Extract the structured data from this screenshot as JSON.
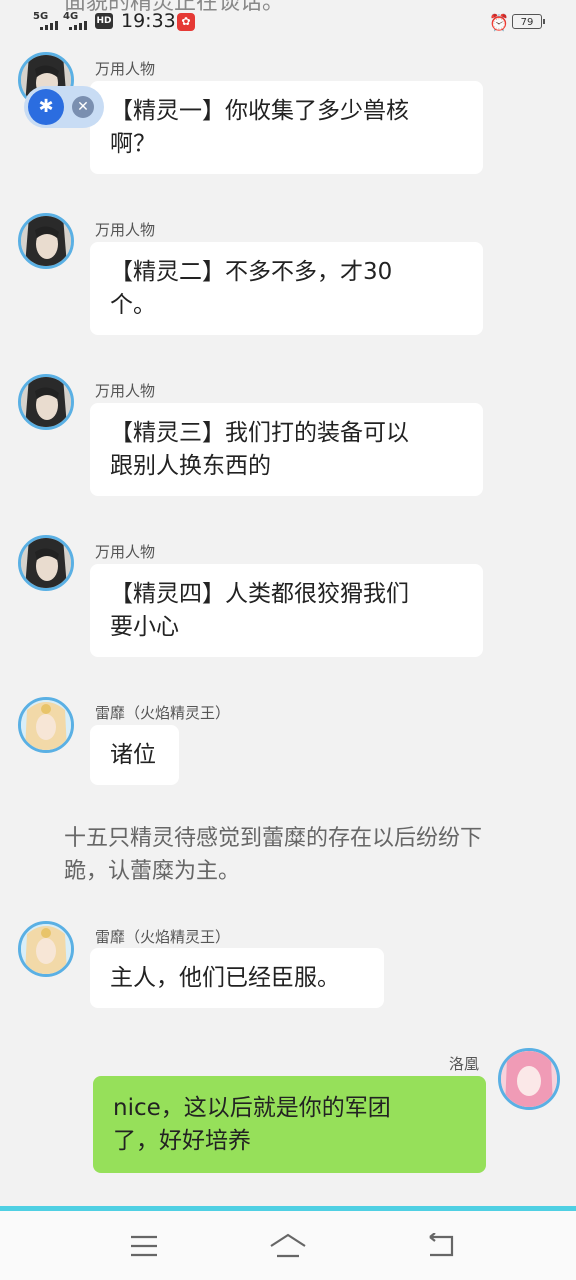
{
  "status_bar": {
    "prev_text": "面貌的精灵正在谈话。",
    "net1": "5G",
    "net2": "4G",
    "hd": "HD",
    "time": "19:33",
    "battery": "79"
  },
  "messages": [
    {
      "sender": "万用人物",
      "text_line1": "【精灵一】你收集了多少兽核",
      "text_line2": "啊？"
    },
    {
      "sender": "万用人物",
      "text_line1": "【精灵二】不多不多，才30",
      "text_line2": "个。"
    },
    {
      "sender": "万用人物",
      "text_line1": "【精灵三】我们打的装备可以",
      "text_line2": "跟别人换东西的"
    },
    {
      "sender": "万用人物",
      "text_line1": "【精灵四】人类都很狡猾我们",
      "text_line2": "要小心"
    },
    {
      "sender": "雷靡（火焰精灵王）",
      "text_line1": "诸位"
    }
  ],
  "narration": "十五只精灵待感觉到蕾糜的存在以后纷纷下跪，认蕾糜为主。",
  "message6": {
    "sender": "雷靡（火焰精灵王）",
    "text": "主人，他们已经臣服。"
  },
  "my_message": {
    "sender": "洛凰",
    "line1": "nice，这以后就是你的军团",
    "line2": "了，好好培养"
  },
  "navbar": {
    "menu_icon": "menu-icon",
    "home_icon": "home-icon",
    "back_icon": "back-icon"
  }
}
